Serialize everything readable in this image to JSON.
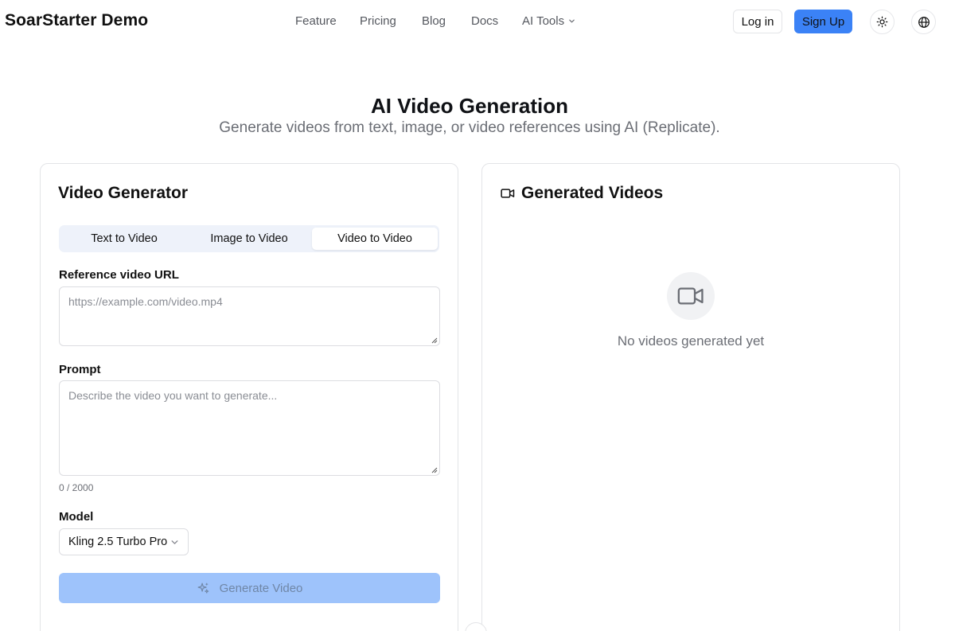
{
  "header": {
    "brand": "SoarStarter Demo",
    "nav": {
      "feature": "Feature",
      "pricing": "Pricing",
      "blog": "Blog",
      "docs": "Docs",
      "ai_tools": "AI Tools"
    },
    "login_label": "Log in",
    "signup_label": "Sign Up",
    "icons": {
      "theme": "sun-icon",
      "language": "globe-icon"
    }
  },
  "hero": {
    "title": "AI Video Generation",
    "subtitle": "Generate videos from text, image, or video references using AI (Replicate)."
  },
  "generator": {
    "title": "Video Generator",
    "tabs": [
      {
        "label": "Text to Video",
        "active": false
      },
      {
        "label": "Image to Video",
        "active": false
      },
      {
        "label": "Video to Video",
        "active": true
      }
    ],
    "reference_label": "Reference video URL",
    "reference_value": "",
    "reference_placeholder": "https://example.com/video.mp4",
    "prompt_label": "Prompt",
    "prompt_value": "",
    "prompt_placeholder": "Describe the video you want to generate...",
    "char_counter": "0 / 2000",
    "model_label": "Model",
    "model_selected": "Kling 2.5 Turbo Pro",
    "generate_label": "Generate Video",
    "generate_disabled": true
  },
  "results": {
    "title": "Generated Videos",
    "empty_text": "No videos generated yet"
  },
  "colors": {
    "primary": "#3b82f6",
    "primary_disabled": "#9ec3fb",
    "tabs_bg": "#eef2fa",
    "border": "#e3e4e7",
    "muted_text": "#6b6e75"
  }
}
